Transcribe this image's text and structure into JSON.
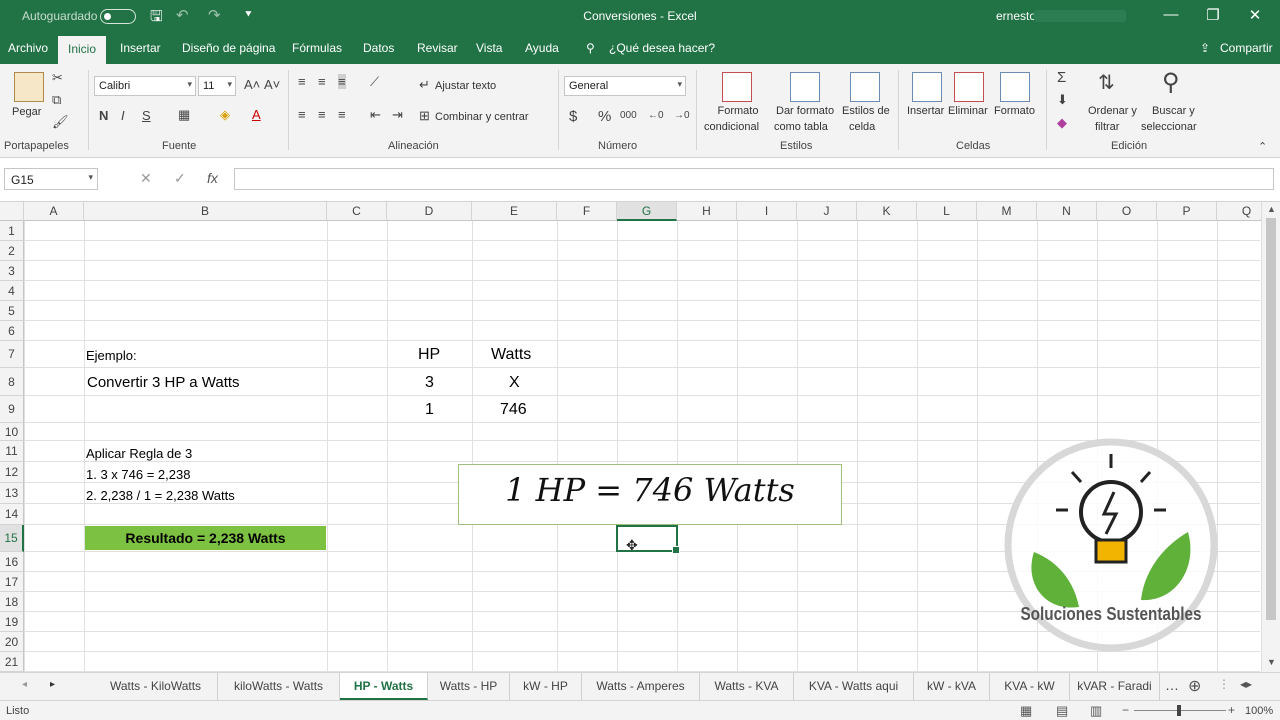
{
  "titlebar": {
    "autosave": "Autoguardado",
    "title": "Conversiones  -  Excel",
    "user": "ernesto"
  },
  "ribbon_tabs": [
    "Archivo",
    "Inicio",
    "Insertar",
    "Diseño de página",
    "Fórmulas",
    "Datos",
    "Revisar",
    "Vista",
    "Ayuda",
    "¿Qué desea hacer?",
    "Compartir"
  ],
  "ribbon": {
    "groups": [
      "Portapapeles",
      "Fuente",
      "Alineación",
      "Número",
      "Estilos",
      "Celdas",
      "Edición"
    ],
    "paste": "Pegar",
    "font": "Calibri",
    "size": "11",
    "wrap": "Ajustar texto",
    "merge": "Combinar y centrar",
    "number_format": "General",
    "cond": [
      "Formato",
      "condicional"
    ],
    "table": [
      "Dar formato",
      "como tabla"
    ],
    "cellstyles": [
      "Estilos de",
      "celda"
    ],
    "insert": "Insertar",
    "delete": "Eliminar",
    "format": "Formato",
    "sort": [
      "Ordenar y",
      "filtrar"
    ],
    "find": [
      "Buscar y",
      "seleccionar"
    ]
  },
  "namebox": "G15",
  "columns": [
    "A",
    "B",
    "C",
    "D",
    "E",
    "F",
    "G",
    "H",
    "I",
    "J",
    "K",
    "L",
    "M",
    "N",
    "O",
    "P",
    "Q"
  ],
  "rows": [
    "1",
    "2",
    "3",
    "4",
    "5",
    "6",
    "7",
    "8",
    "9",
    "10",
    "11",
    "12",
    "13",
    "14",
    "15",
    "16",
    "17",
    "18",
    "19",
    "20",
    "21"
  ],
  "cells": {
    "b7": "Ejemplo:",
    "d7": "HP",
    "e7": "Watts",
    "b8": "Convertir 3 HP a Watts",
    "d8": "3",
    "e8": "X",
    "d9": "1",
    "e9": "746",
    "b11": "Aplicar Regla de 3",
    "b12": "1. 3 x 746 = 2,238",
    "b13": "2. 2,238 / 1 = 2,238 Watts",
    "b15": "Resultado = 2,238 Watts"
  },
  "equation": "1 HP = 746 Watts",
  "logo_text": "Soluciones Sustentables",
  "sheets": [
    "Watts - KiloWatts",
    "kiloWatts - Watts",
    "HP - Watts",
    "Watts - HP",
    "kW - HP",
    "Watts - Amperes",
    "Watts - KVA",
    "KVA - Watts aqui",
    "kW - kVA",
    "KVA - kW",
    "kVAR - Faradi"
  ],
  "status": {
    "ready": "Listo",
    "zoom": "100%"
  },
  "colors": {
    "excel_green": "#217346",
    "result_fill": "#7cc142"
  }
}
